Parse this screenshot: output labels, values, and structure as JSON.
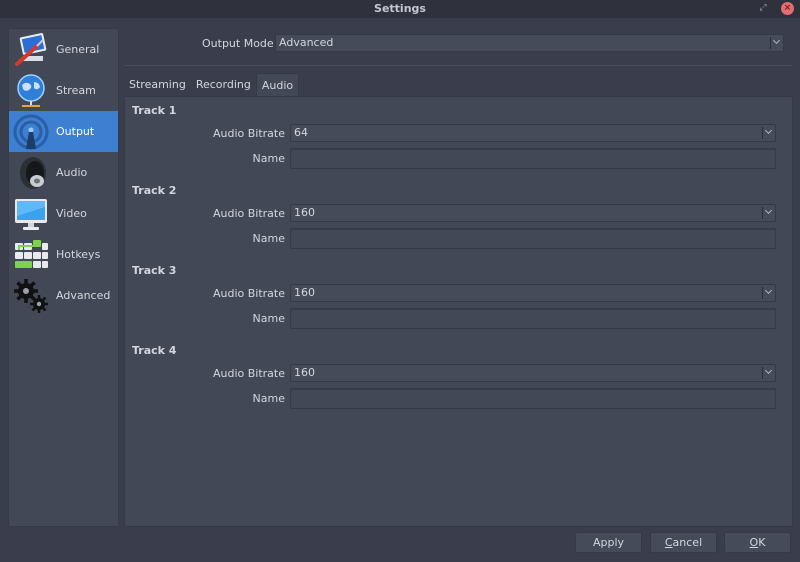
{
  "window": {
    "title": "Settings",
    "restore_icon": "restore-icon",
    "close_icon": "close-icon"
  },
  "sidebar": {
    "items": [
      {
        "label": "General",
        "icon": "general-tools-icon",
        "active": false
      },
      {
        "label": "Stream",
        "icon": "globe-network-icon",
        "active": false
      },
      {
        "label": "Output",
        "icon": "broadcast-antenna-icon",
        "active": true
      },
      {
        "label": "Audio",
        "icon": "speaker-icon",
        "active": false
      },
      {
        "label": "Video",
        "icon": "monitor-icon",
        "active": false
      },
      {
        "label": "Hotkeys",
        "icon": "keyboard-icon",
        "active": false
      },
      {
        "label": "Advanced",
        "icon": "gears-icon",
        "active": false
      }
    ],
    "active_color": "#3d7fd1"
  },
  "output_mode": {
    "label": "Output Mode",
    "value": "Advanced"
  },
  "tabs": [
    {
      "label": "Streaming",
      "active": false
    },
    {
      "label": "Recording",
      "active": false
    },
    {
      "label": "Audio",
      "active": true
    }
  ],
  "tracks": [
    {
      "title": "Track 1",
      "bitrate_label": "Audio Bitrate",
      "bitrate": "64",
      "name_label": "Name",
      "name": ""
    },
    {
      "title": "Track 2",
      "bitrate_label": "Audio Bitrate",
      "bitrate": "160",
      "name_label": "Name",
      "name": ""
    },
    {
      "title": "Track 3",
      "bitrate_label": "Audio Bitrate",
      "bitrate": "160",
      "name_label": "Name",
      "name": ""
    },
    {
      "title": "Track 4",
      "bitrate_label": "Audio Bitrate",
      "bitrate": "160",
      "name_label": "Name",
      "name": ""
    }
  ],
  "buttons": {
    "apply": "Apply",
    "cancel_first": "C",
    "cancel_rest": "ancel",
    "ok_first": "O",
    "ok_rest": "K"
  }
}
